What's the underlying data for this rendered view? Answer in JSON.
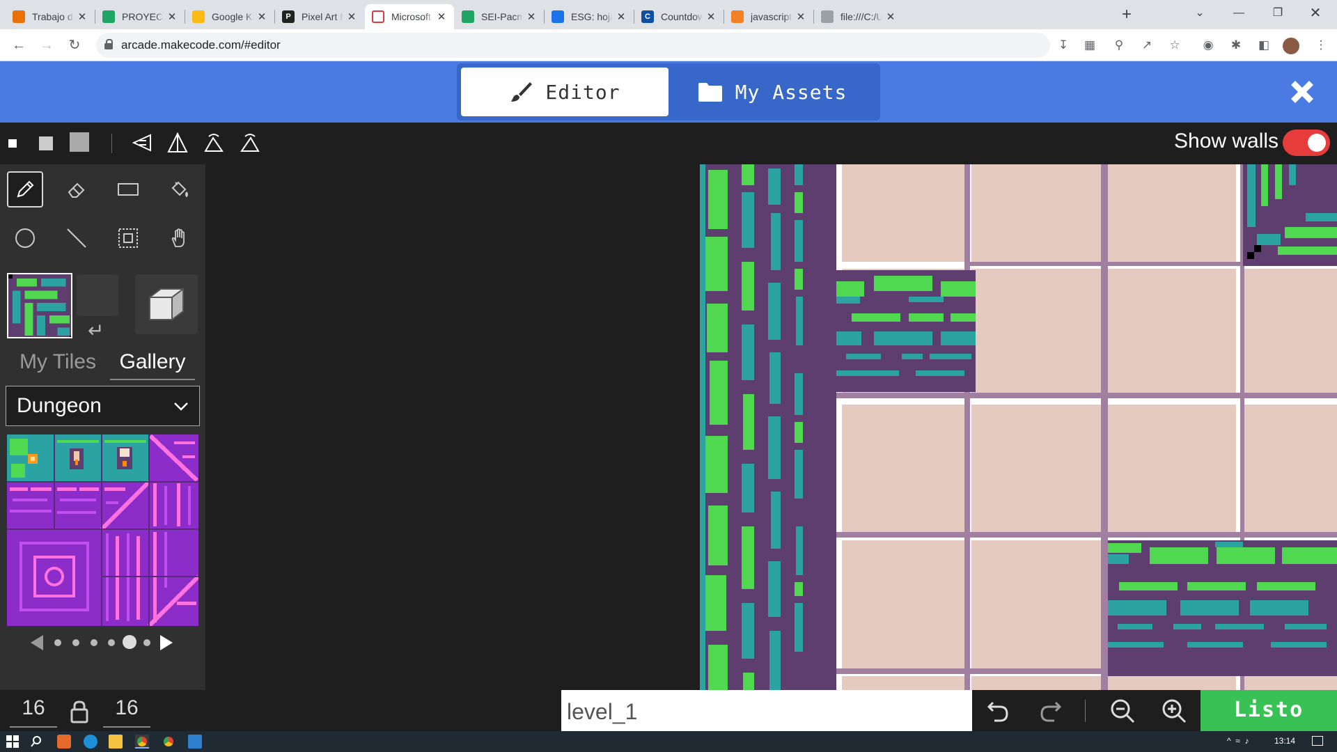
{
  "browser": {
    "tabs": [
      {
        "title": "Trabajo de cl",
        "fav": "orange",
        "active": false
      },
      {
        "title": "PROYECTO -",
        "fav": "drive",
        "active": false
      },
      {
        "title": "Google Keep",
        "fav": "keep",
        "active": false
      },
      {
        "title": "Pixel Art Mak",
        "fav": "pixel",
        "active": false
      },
      {
        "title": "Microsoft Ma",
        "fav": "makecode",
        "active": true
      },
      {
        "title": "SEI-Pacman-",
        "fav": "drive",
        "active": false
      },
      {
        "title": "ESG: hoja de",
        "fav": "diamond",
        "active": false
      },
      {
        "title": "Countdown J",
        "fav": "countdown",
        "active": false
      },
      {
        "title": "javascript - R",
        "fav": "so",
        "active": false
      },
      {
        "title": "file:///C:/User",
        "fav": "globe",
        "active": false
      }
    ],
    "url": "arcade.makecode.com/#editor"
  },
  "header": {
    "editor_tab": "Editor",
    "assets_tab": "My Assets"
  },
  "toolbar": {
    "show_walls_label": "Show walls",
    "show_walls_on": true
  },
  "panel": {
    "tab_my_tiles": "My Tiles",
    "tab_gallery": "Gallery",
    "category": "Dungeon"
  },
  "bottom": {
    "width": "16",
    "height": "16",
    "level_name": "level_1",
    "done_label": "Listo"
  },
  "taskbar": {
    "time": "13:14"
  },
  "colors": {
    "header_blue": "#4a7be3",
    "done_green": "#38c154",
    "toggle_red": "#e73c3c"
  }
}
